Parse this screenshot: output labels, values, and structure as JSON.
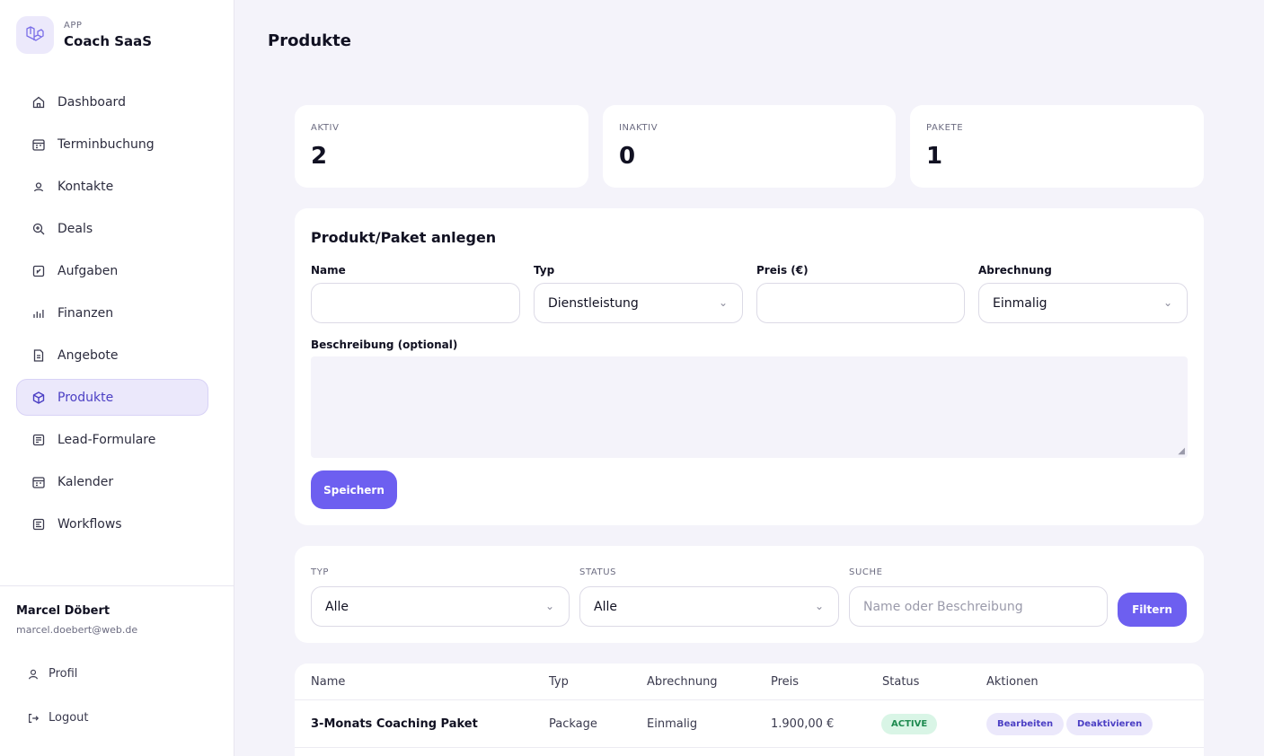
{
  "brand": {
    "app_label": "APP",
    "name": "Coach SaaS",
    "icon": "laravel-logo-icon"
  },
  "nav": [
    {
      "label": "Dashboard",
      "icon": "home-icon"
    },
    {
      "label": "Terminbuchung",
      "icon": "calendar-booking-icon"
    },
    {
      "label": "Kontakte",
      "icon": "user-icon"
    },
    {
      "label": "Deals",
      "icon": "zoom-plus-icon"
    },
    {
      "label": "Aufgaben",
      "icon": "task-icon"
    },
    {
      "label": "Finanzen",
      "icon": "bar-chart-icon"
    },
    {
      "label": "Angebote",
      "icon": "document-icon"
    },
    {
      "label": "Produkte",
      "icon": "cube-icon",
      "active": true
    },
    {
      "label": "Lead-Formulare",
      "icon": "form-icon"
    },
    {
      "label": "Kalender",
      "icon": "calendar-icon"
    },
    {
      "label": "Workflows",
      "icon": "workflow-icon"
    }
  ],
  "user": {
    "name": "Marcel Döbert",
    "email": "marcel.doebert@web.de"
  },
  "side_links": {
    "profile": "Profil",
    "logout": "Logout"
  },
  "page_title": "Produkte",
  "stats": [
    {
      "label": "AKTIV",
      "value": "2"
    },
    {
      "label": "INAKTIV",
      "value": "0"
    },
    {
      "label": "PAKETE",
      "value": "1"
    }
  ],
  "form": {
    "title": "Produkt/Paket anlegen",
    "name_label": "Name",
    "name_value": "",
    "type_label": "Typ",
    "type_value": "Dienstleistung",
    "price_label": "Preis (€)",
    "price_value": "",
    "billing_label": "Abrechnung",
    "billing_value": "Einmalig",
    "description_label": "Beschreibung (optional)",
    "save_label": "Speichern"
  },
  "filters": {
    "type_label": "TYP",
    "type_value": "Alle",
    "status_label": "STATUS",
    "status_value": "Alle",
    "search_label": "SUCHE",
    "search_placeholder": "Name oder Beschreibung",
    "filter_button": "Filtern"
  },
  "table": {
    "columns": [
      "Name",
      "Typ",
      "Abrechnung",
      "Preis",
      "Status",
      "Aktionen"
    ],
    "rows": [
      {
        "name": "3-Monats Coaching Paket",
        "type": "Package",
        "billing": "Einmalig",
        "price": "1.900,00 €",
        "status": "ACTIVE",
        "edit": "Bearbeiten",
        "deactivate": "Deaktivieren"
      }
    ]
  },
  "colors": {
    "accent": "#6d5ff0",
    "active_nav_bg": "#ebe8fb",
    "status_active_bg": "#d9f5e6",
    "status_active_fg": "#1d8a4f",
    "page_bg": "#f4f3fa"
  }
}
